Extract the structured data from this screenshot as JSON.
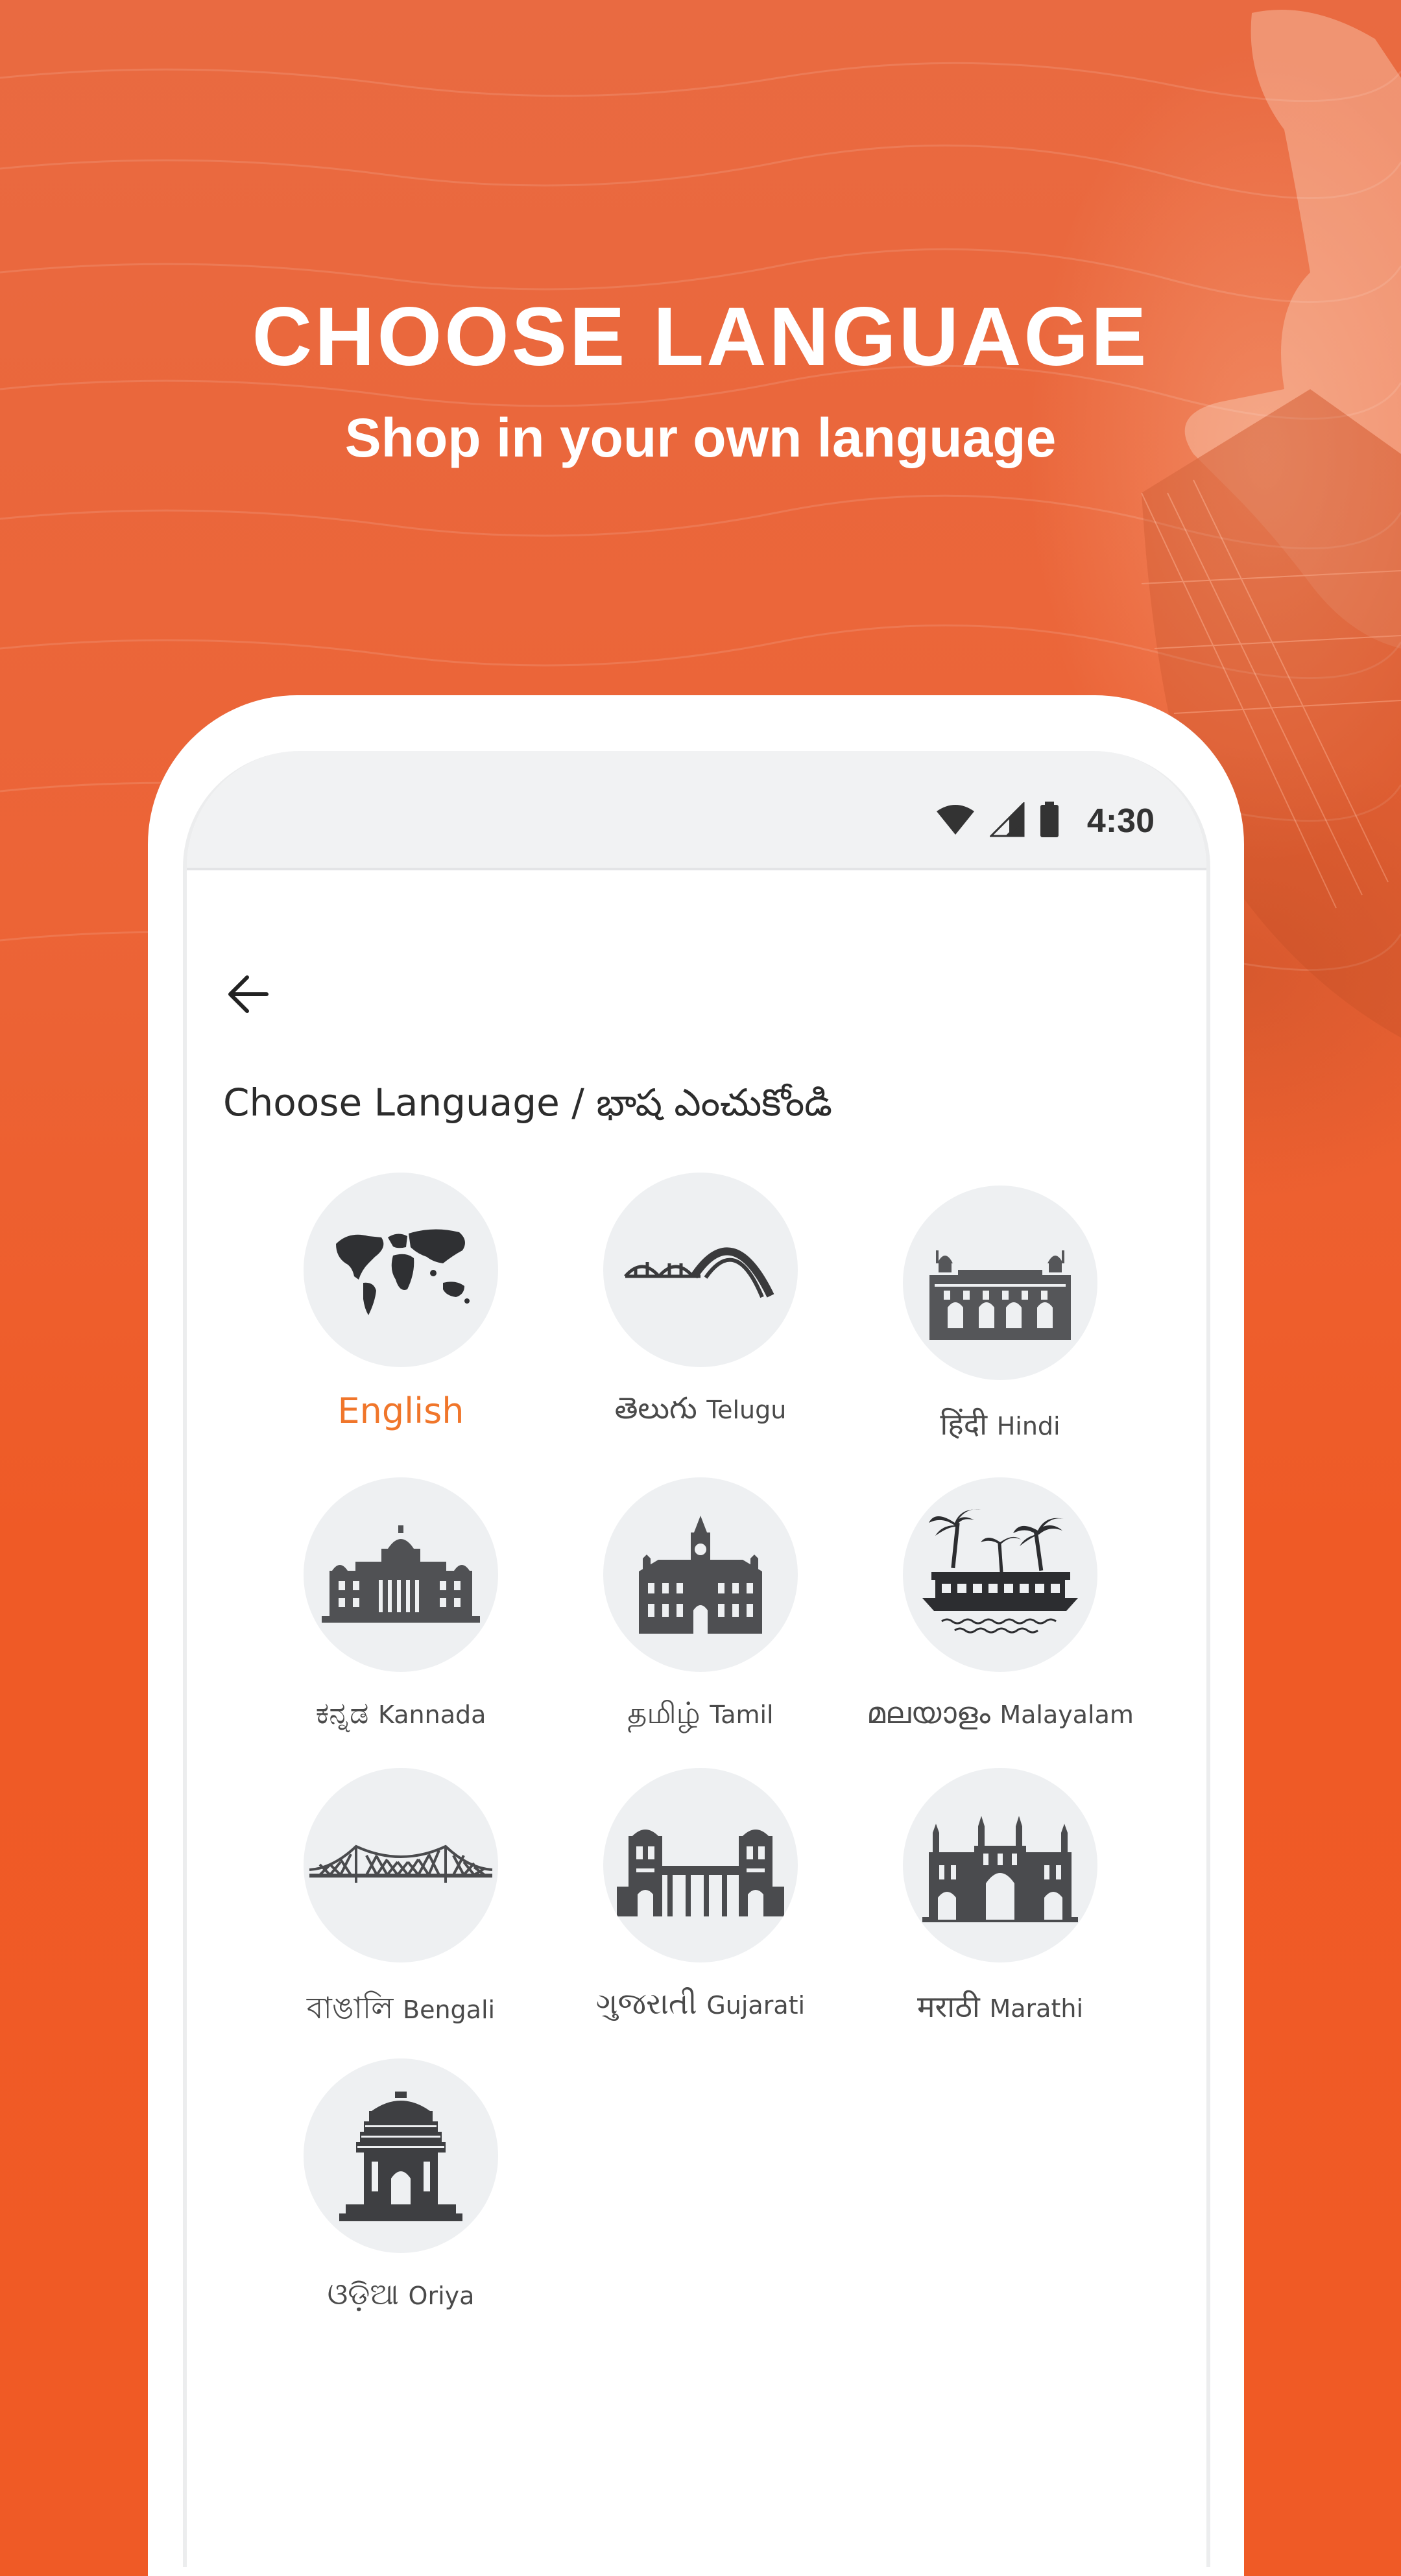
{
  "header": {
    "title": "CHOOSE LANGUAGE",
    "subtitle": "Shop in your own language"
  },
  "status_bar": {
    "time": "4:30",
    "icons": [
      "wifi-icon",
      "signal-icon",
      "battery-icon"
    ]
  },
  "screen": {
    "heading": "Choose Language / భాష ఎంచుకోండి",
    "selected_language": "English",
    "accent_color": "#F0762B",
    "languages": [
      {
        "native": "English",
        "english": "",
        "icon": "world-map-icon"
      },
      {
        "native": "తెలుగు",
        "english": "Telugu",
        "icon": "bridge-arch-icon"
      },
      {
        "native": "हिंदी",
        "english": "Hindi",
        "icon": "red-fort-icon"
      },
      {
        "native": "ಕನ್ನಡ",
        "english": "Kannada",
        "icon": "vidhana-soudha-icon"
      },
      {
        "native": "தமிழ்",
        "english": "Tamil",
        "icon": "central-station-icon"
      },
      {
        "native": "മലയാളം",
        "english": "Malayalam",
        "icon": "houseboat-palm-icon"
      },
      {
        "native": "বাঙালি",
        "english": "Bengali",
        "icon": "howrah-bridge-icon"
      },
      {
        "native": "ગુજરાતી",
        "english": "Gujarati",
        "icon": "gujarat-palace-icon"
      },
      {
        "native": "मराठी",
        "english": "Marathi",
        "icon": "gateway-of-india-icon"
      },
      {
        "native": "ଓଡ଼ିଆ",
        "english": "Oriya",
        "icon": "konark-temple-icon"
      }
    ]
  },
  "colors": {
    "background": "#EF5A26",
    "card": "#FFFFFF",
    "status_bar": "#F1F2F3",
    "circle": "#EEF0F2"
  }
}
